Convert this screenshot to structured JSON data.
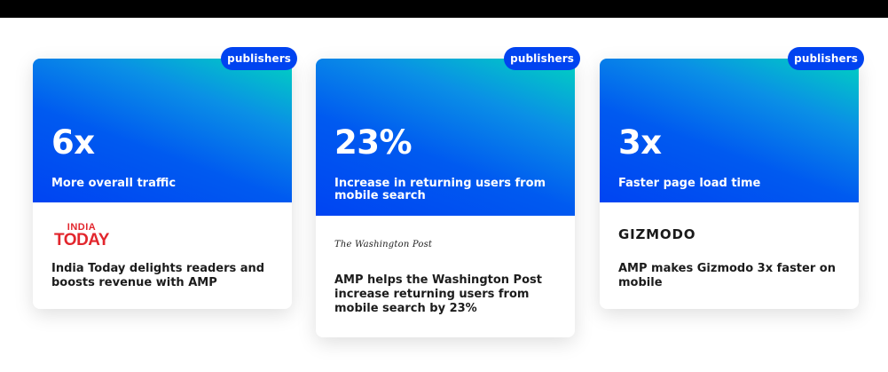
{
  "cards": [
    {
      "tag": "publishers",
      "stat": "6x",
      "stat_label": "More overall traffic",
      "logo": {
        "line1": "INDIA",
        "line2": "TODAY",
        "color": "#e2262d"
      },
      "headline": "India Today delights readers and boosts revenue with AMP"
    },
    {
      "tag": "publishers",
      "stat": "23%",
      "stat_label": "Increase in returning users from mobile search",
      "logo": {
        "text": "The Washington Post"
      },
      "headline": "AMP helps the Washington Post increase returning users from mobile search by 23%"
    },
    {
      "tag": "publishers",
      "stat": "3x",
      "stat_label": "Faster page load time",
      "logo": {
        "text": "GIZMODO"
      },
      "headline": "AMP makes Gizmodo 3x faster on mobile"
    }
  ],
  "colors": {
    "gradient_start": "#00d3c0",
    "gradient_end": "#0044f2",
    "tag_bg": "#0043f0",
    "india_today_red": "#e2262d"
  }
}
